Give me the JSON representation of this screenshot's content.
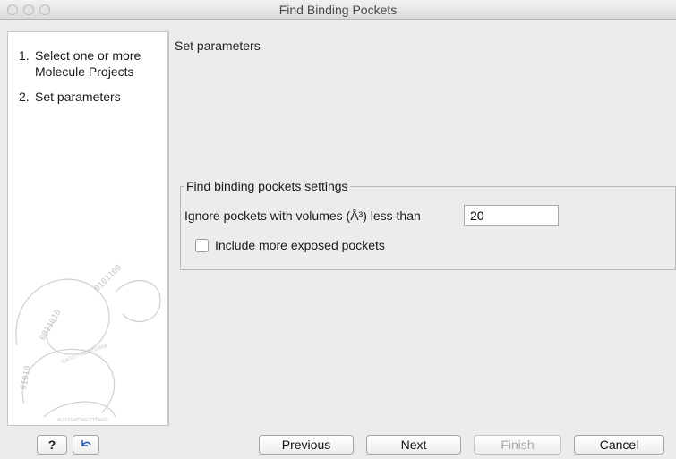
{
  "window": {
    "title": "Find Binding Pockets"
  },
  "sidebar": {
    "steps": [
      {
        "number": "1.",
        "label_line1": "Select one or more",
        "label_line2": "Molecule Projects"
      },
      {
        "number": "2.",
        "label_line1": "Set parameters"
      }
    ]
  },
  "main": {
    "section_title": "Set parameters",
    "settings_group": {
      "legend": "Find binding pockets settings",
      "volume_label": "Ignore pockets with volumes (Å³) less than",
      "volume_value": "20",
      "include_exposed_label": "Include more exposed pockets",
      "include_exposed_checked": false
    }
  },
  "footer": {
    "help_icon": "question-mark-icon",
    "reset_icon": "reset-arrow-icon",
    "help_label": "?",
    "previous_label": "Previous",
    "next_label": "Next",
    "finish_label": "Finish",
    "cancel_label": "Cancel"
  },
  "colors": {
    "window_bg": "#ececec",
    "sidebar_bg": "#ffffff",
    "disabled_text": "#a8a8a8"
  }
}
